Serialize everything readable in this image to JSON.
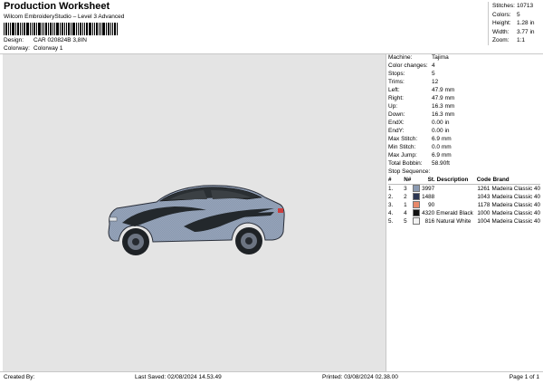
{
  "header": {
    "title": "Production Worksheet",
    "subtitle": "Wilcom EmbroideryStudio – Level 3 Advanced",
    "design_label": "Design:",
    "design_value": "CAR 020824B 3,8IN",
    "colorway_label": "Colorway:",
    "colorway_value": "Colorway 1"
  },
  "stats": [
    {
      "label": "Stitches:",
      "value": "10713"
    },
    {
      "label": "Colors:",
      "value": "5"
    },
    {
      "label": "Height:",
      "value": "1.28 in"
    },
    {
      "label": "Width:",
      "value": "3.77 in"
    },
    {
      "label": "Zoom:",
      "value": "1:1"
    }
  ],
  "info": [
    {
      "label": "Machine:",
      "value": "Tajima"
    },
    {
      "label": "Color changes:",
      "value": "4"
    },
    {
      "label": "Stops:",
      "value": "5"
    },
    {
      "label": "Trims:",
      "value": "12"
    },
    {
      "label": "Left:",
      "value": "47.9 mm"
    },
    {
      "label": "Right:",
      "value": "47.9 mm"
    },
    {
      "label": "Up:",
      "value": "16.3 mm"
    },
    {
      "label": "Down:",
      "value": "16.3 mm"
    },
    {
      "label": "EndX:",
      "value": "0.00 in"
    },
    {
      "label": "EndY:",
      "value": "0.00 in"
    },
    {
      "label": "Max Stitch:",
      "value": "6.9 mm"
    },
    {
      "label": "Min Stitch:",
      "value": "0.0 mm"
    },
    {
      "label": "Max Jump:",
      "value": "6.9 mm"
    },
    {
      "label": "Total Bobbin:",
      "value": "58.90ft"
    }
  ],
  "stop_sequence": {
    "title": "Stop Sequence:",
    "headers": {
      "num": "#",
      "n": "N#",
      "st": "St.",
      "desc": "Description",
      "code": "Code",
      "brand": "Brand"
    },
    "rows": [
      {
        "num": "1.",
        "n": "3",
        "color": "#8b9ab2",
        "st": "3997",
        "desc": "",
        "code": "1261",
        "brand": "Madeira Classic 40"
      },
      {
        "num": "2.",
        "n": "2",
        "color": "#2c3652",
        "st": "1488",
        "desc": "",
        "code": "1043",
        "brand": "Madeira Classic 40"
      },
      {
        "num": "3.",
        "n": "1",
        "color": "#e8896a",
        "st": "90",
        "desc": "",
        "code": "1178",
        "brand": "Madeira Classic 40"
      },
      {
        "num": "4.",
        "n": "4",
        "color": "#111111",
        "st": "4320",
        "desc": "Emerald Black",
        "code": "1000",
        "brand": "Madeira Classic 40"
      },
      {
        "num": "5.",
        "n": "5",
        "color": "#f2f2f2",
        "st": "816",
        "desc": "Natural White",
        "code": "1004",
        "brand": "Madeira Classic 40"
      }
    ]
  },
  "footer": {
    "created_by": "Created By:",
    "last_saved": "Last Saved: 02/08/2024 14.53.49",
    "printed": "Printed: 03/08/2024 02.38.00",
    "page": "Page 1 of 1"
  }
}
